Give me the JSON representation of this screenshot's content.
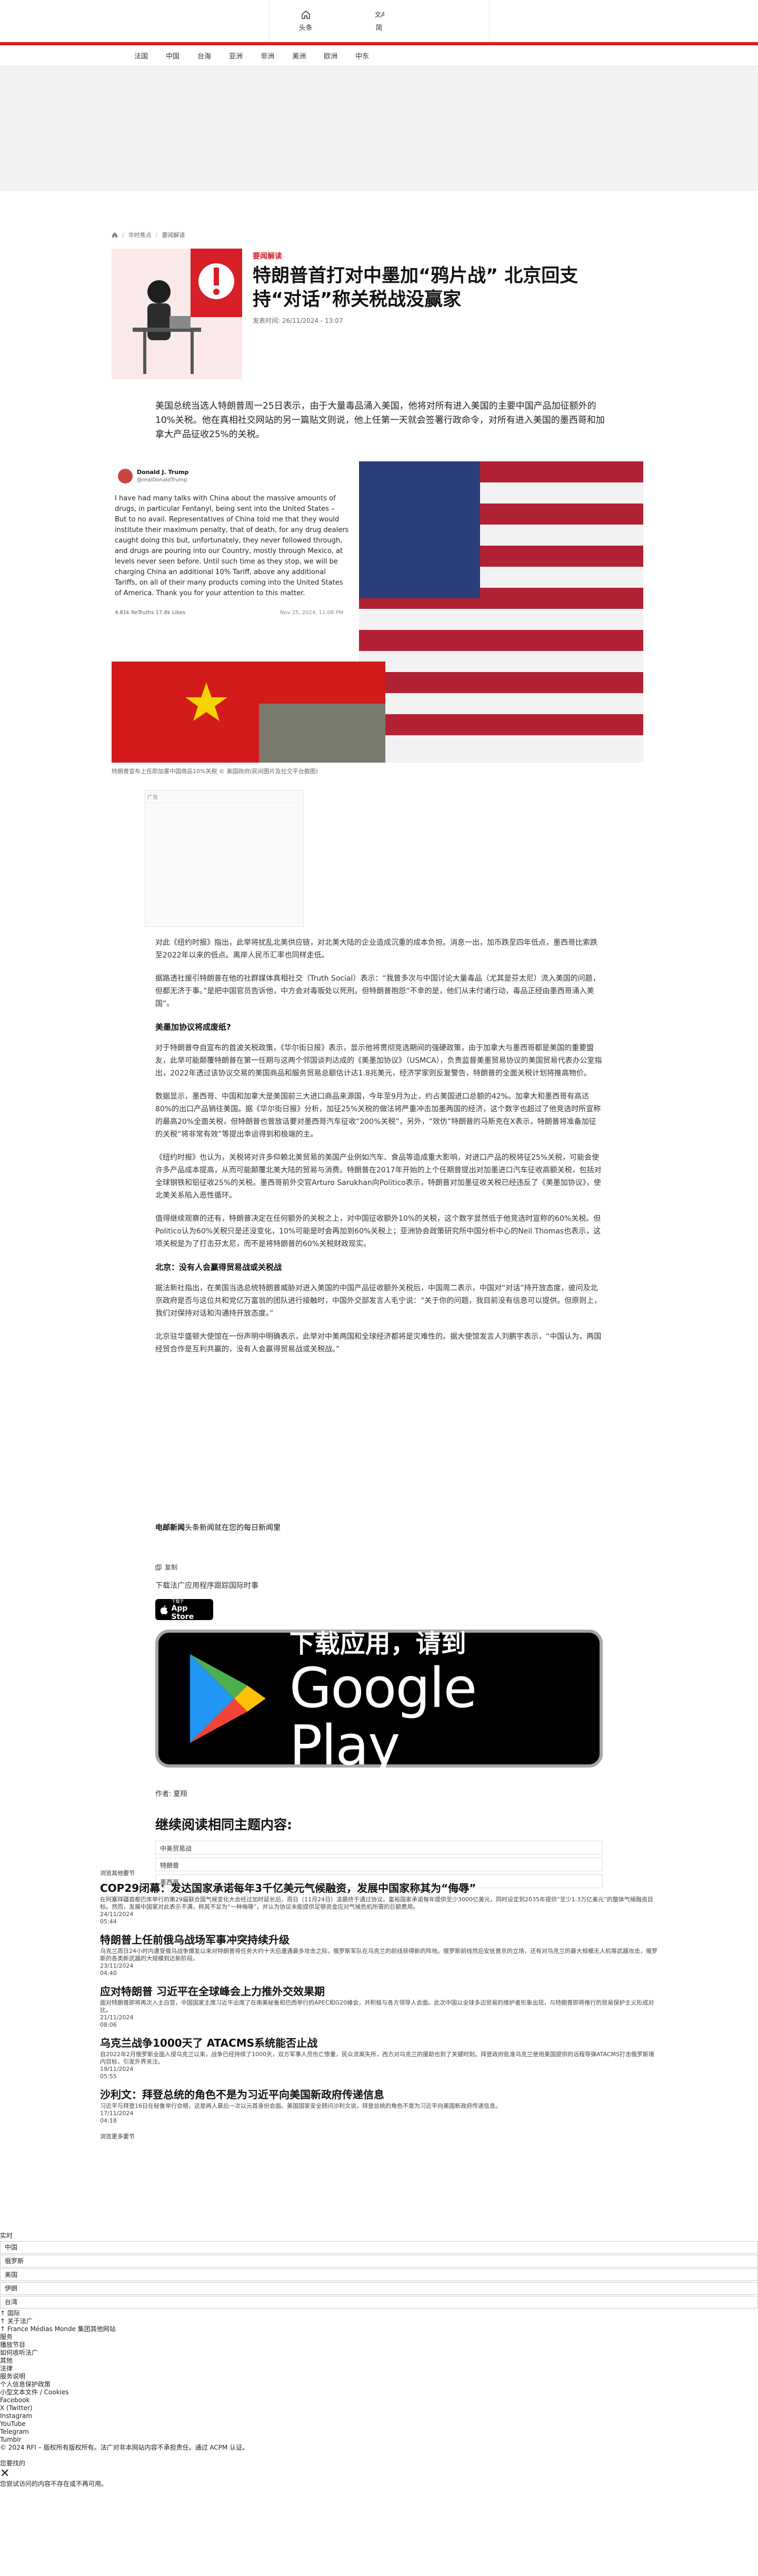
{
  "topbar": {
    "home_label": "头条",
    "lang_label": "简"
  },
  "nav": {
    "items": [
      "法国",
      "中国",
      "台海",
      "亚洲",
      "非洲",
      "美洲",
      "欧洲",
      "中东"
    ]
  },
  "breadcrumb": [
    "首页",
    "华时焦点",
    "要闻解读"
  ],
  "article": {
    "kicker": "要闻解读",
    "title": "特朗普首打对中墨加“鸦片战” 北京回支持“对话”称关税战没赢家",
    "pubdate": "发表时间: 26/11/2024 - 13:07",
    "lead": "美国总统当选人特朗普周一25日表示，由于大量毒品涌入美国，他将对所有进入美国的主要中国产品加征额外的10%关税。他在真相社交网站的另一篇贴文则说，他上任第一天就会签署行政命令，对所有进入美国的墨西哥和加拿大产品征收25%的关税。",
    "photo_caption": "特朗普宣布上任即加墨中国商品10%关税 © 美国政府(民间图片及社交平台截图)",
    "ad_label": "广告",
    "paragraphs": [
      "对此《纽约时报》指出，此举将扰乱北美供应链，对北美大陆的企业造成沉重的成本负担。消息一出，加币跌至四年低点，墨西哥比索跌至2022年以来的低点。离岸人民币汇率也同样走低。",
      "据路透社援引特朗普在他的社群媒体真相社交（Truth Social）表示：“我曾多次与中国讨论大量毒品（尤其是芬太尼）流入美国的问题，但都无济于事。”是把中国官员告诉他，中方会对毒贩处以死刑。但特朗普抱怨“不幸的是，他们从未付诸行动，毒品正经由墨西哥涌入美国”。"
    ],
    "h3_1": "美墨加协议将成废纸?",
    "paragraphs_2": [
      "对于特朗普夺自宣布的首波关税政策，《华尔街日报》表示，显示他将贯彻竞选期间的强硬政策，由于加拿大与墨西哥都是美国的重要盟友，此举可能颠覆特朗普在第一任期与这两个邻国谈判达成的《美墨加协议》（USMCA），负责监督美墨贸易协议的美国贸易代表办公室指出，2022年透过该协议交易的美国商品和服务贸易总额估计达1.8兆美元，经济学家则反复警告，特朗普的全面关税计划将推高物价。",
      "数据显示，墨西哥、中国和加拿大是美国前三大进口商品来源国，今年至9月为止，约占美国进口总额的42%。加拿大和墨西哥有高达80%的出口产品销往美国。据《华尔街日报》分析，加征25%关税的做法将严重冲击加墨两国的经济，这个数字也超过了他竞选时所宣称的最高20%全面关税，但特朗普也曾放话要对墨西哥汽车征收“200%关税”，另外，“效仿”特朗普的马斯克在X表示，特朗普将准备加征的关税“将非常有效”等提出幸运得到和极端的主。",
      "《纽约时报》也认为，关税将对许多仰赖北美贸易的美国产业例如汽车、食品等造成重大影响，对进口产品的税将征25%关税，可能会使许多产品成本提高，从而可能颠覆北美大陆的贸易与消费。特朗普在2017年开始的上个任期曾提出对加墨进口汽车征收高额关税，包括对全球钢铁和铝征收25%的关税。墨西哥前外交官Arturo Sarukhan向Politico表示，特朗普对加墨征收关税已经违反了《美墨加协议》，使北美关系陷入恶性循环。",
      "值得继续观察的还有，特朗普决定在任何额外的关税之上，对中国征收额外10%的关税，这个数字显然低于他竞选时宣称的60%关税。但Politico认为60%关税只是还没变化，10%可能是时会再加到60%关税上；亚洲协会政策研究所中国分析中心的Neil Thomas也表示，这项关税是为了打击芬太尼，而不是将特朗普的60%关税财政现实。"
    ],
    "h3_2": "北京：没有人会赢得贸易战或关税战",
    "paragraphs_3": [
      "据法新社指出，在美国当选总统特朗普威胁对进入美国的中国产品征收额外关税后，中国周二表示，中国对“对话”持开放态度，彼问及北京政府是否与这位共和党亿万富翁的团队进行接触时，中国外交部发言人毛宁说：“关于你的问题，我目前没有信息可以提供。但原则上，我们对保持对话和沟通持开放态度。”",
      "北京驻华盛顿大使馆在一份声明中明确表示，此举对中美两国和全球经济都将是灾难性的。据大使馆发言人刘鹏宇表示，“中国认为，两国经贸合作是互利共赢的，没有人会赢得贸易战或关税战。”"
    ],
    "follow_bold": "电邮新闻",
    "follow_rest": "头条新闻就在您的每日新闻里",
    "copy_label": "复制",
    "download_text": "下载法广应用程序跟踪国际时事",
    "appstore_small": "下载于",
    "appstore_big": "App Store",
    "gplay_small": "下载应用，请到",
    "gplay_big": "Google Play",
    "author": "作者: 夏翔"
  },
  "related": {
    "heading": "继续阅读相同主题内容:",
    "items": [
      "中美贸易战",
      "特朗普",
      "墨西哥"
    ]
  },
  "news": {
    "label": "浏览其他要节",
    "items": [
      {
        "title": "COP29闭幕：发达国家承诺每年3千亿美元气候融资，发展中国家称其为“侮辱”",
        "excerpt": "在阿塞拜疆首都巴库举行的第29届联合国气候变化大会经过加时延长后，周日（11月24日）凌晨终于通过协议。富裕国家承诺每年提供至少3000亿美元，同时设定到2035年提供“至少1.3万亿美元”的整体气候融资目标。然而，发展中国家对此表示不满，称其不足为“一种侮辱”，并认为协议未能提供足够资金应对气候危机所需的巨额费用。",
        "date": "24/11/2024",
        "time": "05:44"
      },
      {
        "title": "特朗普上任前俄乌战场军事冲突持续升级",
        "excerpt": "乌克兰周日24小时内遭受俄乌战争爆发以来对特朗普将任务大约十天后遭遇最多攻击之际，俄罗斯军队在乌克兰的前线获得新的阵地。俄罗斯前线然后安抚普京的立场，还有对乌克兰的最大规模无人机等武器攻击，俄罗斯的各类新武器的大规模到达新阶段。",
        "date": "23/11/2024",
        "time": "04:40"
      },
      {
        "title": "应对特朗普 习近平在全球峰会上力推外交效果期",
        "excerpt": "面对特朗普即将再次入主白宫，中国国家主席习近平出席了在南美秘鲁和巴西举行的APEC和G20峰会，并积极与各方领导人会面。此次中国以全球多边贸易的维护者形象出现，与特朗普即将推行的贸易保护主义形成对比。",
        "date": "21/11/2024",
        "time": "08:06"
      },
      {
        "title": "乌克兰战争1000天了 ATACMS系统能否止战",
        "excerpt": "自2022年2月俄罗斯全面入侵乌克兰以来，战争已经持续了1000天，双方军事人员伤亡惨重，民众流离失所，西方对乌克兰的援助也到了关键时刻。拜登政府批准乌克兰使用美国提供的远程导弹ATACMS打击俄罗斯境内目标，引发外界关注。",
        "date": "19/11/2024",
        "time": "05:55"
      },
      {
        "title": "沙利文：拜登总统的角色不是为习近平向美国新政府传递信息",
        "excerpt": "习近平与拜登16日在秘鲁举行会晤，这是两人最后一次以元首身份会面。美国国家安全顾问沙利文说，拜登总统的角色不是为习近平向美国新政府传递信息。",
        "date": "17/11/2024",
        "time": "04:18"
      }
    ],
    "see_more": "浏览更多要节"
  },
  "footer": {
    "lines_top": [
      "实时"
    ],
    "inputs": [
      "中国",
      "俄罗斯",
      "美国",
      "伊朗",
      "台湾"
    ],
    "lines_mid": [
      "↑ 国际",
      "↑ 关于法广",
      "↑ France Médias Monde 集团其他网站",
      "服务",
      "播放节目",
      "如何收听法广",
      "其他",
      "法律",
      "服务说明",
      "个人信息保护政策",
      "小型文本文件 / Cookies",
      "Facebook",
      "X (Twitter)",
      "Instagram",
      "YouTube",
      "Telegram",
      "Tumblr"
    ],
    "copyright": "© 2024 RFI – 版权所有版权所有。法广对非本网站内容不承担责任。通过 ACPM 认证。",
    "lines_bottom": [
      "您要找的",
      "您尝试访问的内容不存在或不再可用。"
    ],
    "close": "✕"
  },
  "colors": {
    "brand_red": "#d61f26"
  }
}
